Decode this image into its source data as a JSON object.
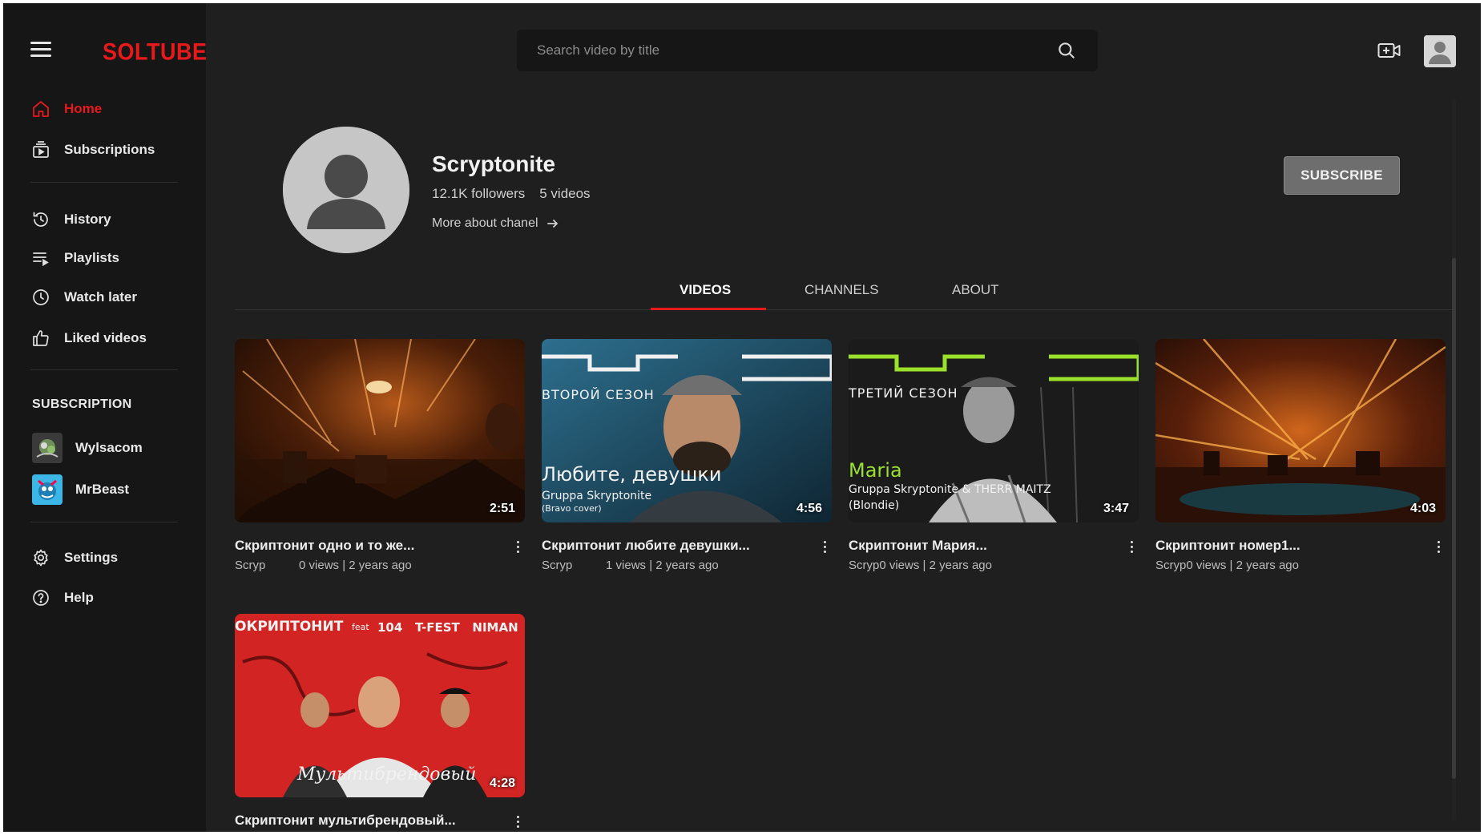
{
  "app": {
    "logo": "SOLTUBE",
    "accent": "#e8191b"
  },
  "sidebar": {
    "main": [
      {
        "label": "Home",
        "icon": "home-icon",
        "active": true
      },
      {
        "label": "Subscriptions",
        "icon": "subscriptions-icon"
      }
    ],
    "library": [
      {
        "label": "History",
        "icon": "history-icon"
      },
      {
        "label": "Playlists",
        "icon": "playlists-icon"
      },
      {
        "label": "Watch later",
        "icon": "watch-later-icon"
      },
      {
        "label": "Liked videos",
        "icon": "thumbs-up-icon"
      }
    ],
    "subscription_heading": "SUBSCRIPTION",
    "subscriptions": [
      {
        "label": "Wylsacom"
      },
      {
        "label": "MrBeast"
      }
    ],
    "footer": [
      {
        "label": "Settings",
        "icon": "gear-icon"
      },
      {
        "label": "Help",
        "icon": "help-icon"
      }
    ]
  },
  "search": {
    "placeholder": "Search video by title"
  },
  "channel": {
    "name": "Scryptonite",
    "followers": "12.1K followers",
    "videos_count": "5 videos",
    "more": "More about chanel",
    "subscribe_label": "SUBSCRIBE"
  },
  "tabs": [
    {
      "label": "VIDEOS",
      "active": true
    },
    {
      "label": "CHANNELS"
    },
    {
      "label": "ABOUT"
    }
  ],
  "videos": [
    {
      "title": "Скриптонит одно и то же...",
      "author": "Scryp",
      "meta": "0 views | 2 years ago",
      "duration": "2:51"
    },
    {
      "title": "Скриптонит любите девушки...",
      "author": "Scryp",
      "meta": "1 views | 2 years ago",
      "duration": "4:56",
      "overlay": {
        "season": "ВТОРОЙ СЕЗОН",
        "song": "Любите, девушки",
        "artist": "Gruppa Skryptonite",
        "note": "(Bravo cover)"
      }
    },
    {
      "title": "Скриптонит Мария...",
      "author": "Scryp",
      "meta": "0 views | 2 years ago",
      "duration": "3:47",
      "overlay": {
        "season": "ТРЕТИЙ СЕЗОН",
        "song": "Maria",
        "artist": "Gruppa Skryptonite & THERR MAITZ",
        "note": "(Blondie)"
      }
    },
    {
      "title": "Скриптонит номер1...",
      "author": "Scryp",
      "meta": "0 views | 2 years ago",
      "duration": "4:03"
    },
    {
      "title": "Скриптонит мультибрендовый...",
      "author": "",
      "meta": "",
      "duration": "4:28",
      "overlay": {
        "top": "ОКРИПТОНИТ",
        "feat": "feat",
        "artists": "104   T-FEST   NIMAN",
        "script": "Мультибрендовый"
      }
    }
  ]
}
